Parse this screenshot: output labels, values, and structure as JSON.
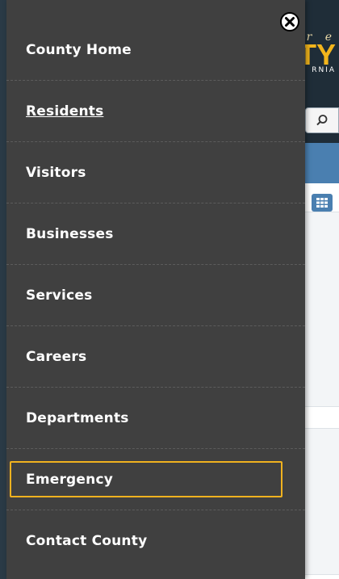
{
  "background": {
    "tagline": "r e",
    "logo_text": "TY",
    "logo_sub": "RNIA"
  },
  "colors": {
    "panel_bg": "#404040",
    "item_text": "#ffffff",
    "focus_outline": "#f0b21f",
    "divider": "#5c5c5c"
  },
  "menu": {
    "close_icon": "close-circle-icon",
    "items": [
      {
        "label": "County Home",
        "state": "normal"
      },
      {
        "label": "Residents",
        "state": "hovered"
      },
      {
        "label": "Visitors",
        "state": "normal"
      },
      {
        "label": "Businesses",
        "state": "normal"
      },
      {
        "label": "Services",
        "state": "normal"
      },
      {
        "label": "Careers",
        "state": "normal"
      },
      {
        "label": "Departments",
        "state": "normal"
      },
      {
        "label": "Emergency",
        "state": "focused"
      },
      {
        "label": "Contact County",
        "state": "normal"
      }
    ]
  }
}
